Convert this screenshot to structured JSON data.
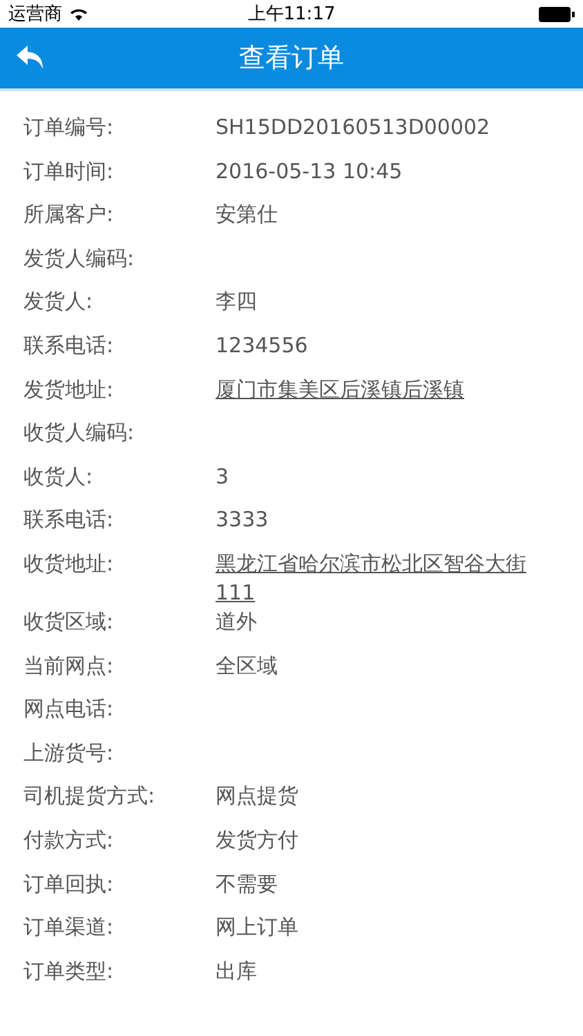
{
  "status_bar": {
    "carrier": "运营商",
    "time": "上午11:17"
  },
  "nav_bar": {
    "title": "查看订单"
  },
  "fields": [
    {
      "label": "订单编号:",
      "value": "SH15DD20160513D00002",
      "kind": "text"
    },
    {
      "label": "订单时间:",
      "value": "2016-05-13 10:45",
      "kind": "text"
    },
    {
      "label": "所属客户:",
      "value": "安第仕",
      "kind": "text"
    },
    {
      "label": "发货人编码:"
    },
    {
      "label": "发货人:",
      "value": "李四",
      "kind": "text"
    },
    {
      "label": "联系电话:",
      "value": "1234556",
      "kind": "text"
    },
    {
      "label": "发货地址:",
      "value": "厦门市集美区后溪镇后溪镇",
      "kind": "link"
    },
    {
      "label": "收货人编码:"
    },
    {
      "label": "收货人:",
      "value": "3",
      "kind": "text"
    },
    {
      "label": "联系电话:",
      "value": "3333",
      "kind": "text"
    },
    {
      "label": "收货地址:",
      "value": "黑龙江省哈尔滨市松北区智谷大街111",
      "kind": "link"
    },
    {
      "label": "收货区域:",
      "value": "道外",
      "kind": "text"
    },
    {
      "label": "当前网点:",
      "value": "全区域",
      "kind": "text"
    },
    {
      "label": "网点电话:"
    },
    {
      "label": "上游货号:"
    },
    {
      "label": "司机提货方式:",
      "value": "网点提货",
      "kind": "text"
    },
    {
      "label": "付款方式:",
      "value": "发货方付",
      "kind": "text"
    },
    {
      "label": "订单回执:",
      "value": "不需要",
      "kind": "text"
    },
    {
      "label": "订单渠道:",
      "value": "网上订单",
      "kind": "text"
    },
    {
      "label": "订单类型:",
      "value": "出库",
      "kind": "text"
    }
  ]
}
